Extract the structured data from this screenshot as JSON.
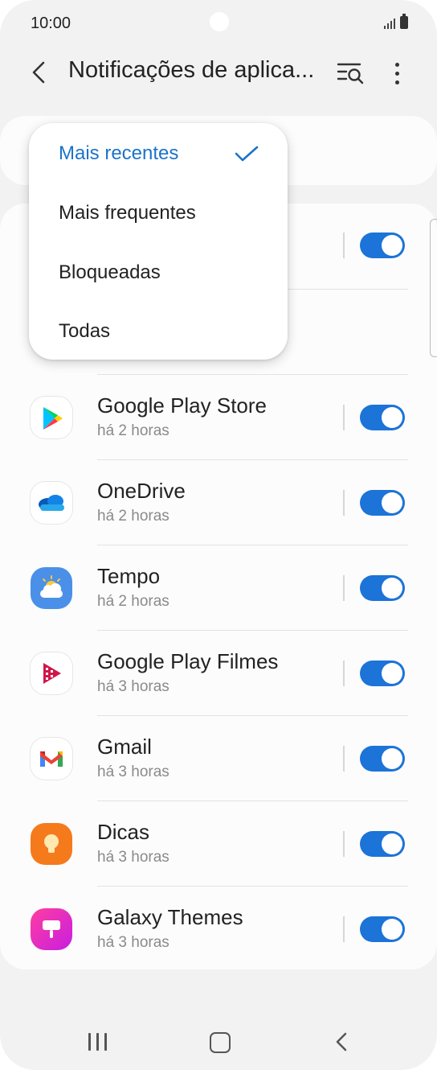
{
  "status_bar": {
    "time": "10:00"
  },
  "header": {
    "title": "Notificações de aplica..."
  },
  "sort_menu": {
    "options": [
      {
        "label": "Mais recentes",
        "selected": true
      },
      {
        "label": "Mais frequentes",
        "selected": false
      },
      {
        "label": "Bloqueadas",
        "selected": false
      },
      {
        "label": "Todas",
        "selected": false
      }
    ]
  },
  "apps": [
    {
      "name": "Google Play Store",
      "time": "há 2 horas",
      "enabled": true,
      "icon": "google-play-store-icon"
    },
    {
      "name": "OneDrive",
      "time": "há 2 horas",
      "enabled": true,
      "icon": "onedrive-icon"
    },
    {
      "name": "Tempo",
      "time": "há 2 horas",
      "enabled": true,
      "icon": "weather-icon"
    },
    {
      "name": "Google Play Filmes",
      "time": "há 3 horas",
      "enabled": true,
      "icon": "google-play-movies-icon"
    },
    {
      "name": "Gmail",
      "time": "há 3 horas",
      "enabled": true,
      "icon": "gmail-icon"
    },
    {
      "name": "Dicas",
      "time": "há 3 horas",
      "enabled": true,
      "icon": "tips-bulb-icon"
    },
    {
      "name": "Galaxy Themes",
      "time": "há 3 horas",
      "enabled": true,
      "icon": "galaxy-themes-icon"
    }
  ],
  "colors": {
    "accent": "#1c73d8",
    "selected_text": "#1c73c8",
    "background": "#f2f2f2"
  }
}
